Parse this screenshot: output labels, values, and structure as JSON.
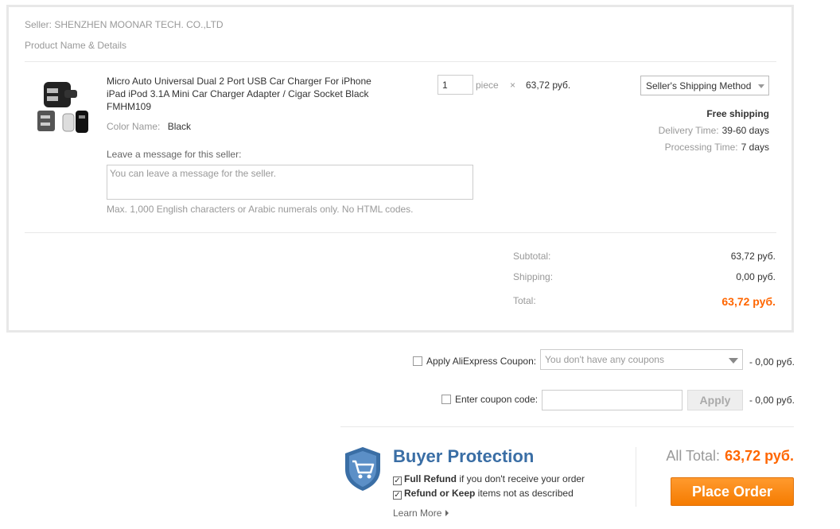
{
  "seller": {
    "text": "Seller: SHENZHEN MOONAR TECH. CO.,LTD"
  },
  "columns": {
    "product_header": "Product Name & Details"
  },
  "product": {
    "title": "Micro Auto Universal Dual 2 Port USB Car Charger For iPhone iPad iPod 3.1A Mini Car Charger Adapter / Cigar Socket Black FMHM109",
    "color_label": "Color Name:",
    "color_value": "Black",
    "quantity": "1",
    "unit": "piece",
    "times": "×",
    "unit_price": "63,72 руб.",
    "image_icon": "product-thumbnail-car-charger"
  },
  "message": {
    "label": "Leave a message for this seller:",
    "placeholder": "You can leave a message for the seller.",
    "hint": "Max. 1,000 English characters or Arabic numerals only. No HTML codes."
  },
  "shipping": {
    "method": "Seller's Shipping Method",
    "free": "Free shipping",
    "delivery_label": "Delivery Time:",
    "delivery_value": "39-60 days",
    "processing_label": "Processing Time:",
    "processing_value": "7 days"
  },
  "summary": {
    "subtotal_label": "Subtotal:",
    "subtotal_value": "63,72 руб.",
    "shipping_label": "Shipping:",
    "shipping_value": "0,00 руб.",
    "total_label": "Total:",
    "total_value": "63,72 руб."
  },
  "coupons": {
    "aliexpress_label": "Apply AliExpress Coupon:",
    "aliexpress_select": "You don't have any coupons",
    "aliexpress_discount": "- 0,00 руб.",
    "code_label": "Enter coupon code:",
    "apply_label": "Apply",
    "code_discount": "- 0,00 руб."
  },
  "protection": {
    "title": "Buyer Protection",
    "line1_bold": "Full Refund",
    "line1_rest": " if you don't receive your order",
    "line2_bold": "Refund or Keep",
    "line2_rest": " items not as described",
    "learn_more": "Learn More",
    "check_glyph": "✓"
  },
  "order": {
    "all_total_label": "All Total:",
    "all_total_value": "63,72 руб.",
    "place_order": "Place Order"
  },
  "colors": {
    "accent": "#f60",
    "protection_blue": "#3a6ea5",
    "button_orange": "#f57b00"
  }
}
